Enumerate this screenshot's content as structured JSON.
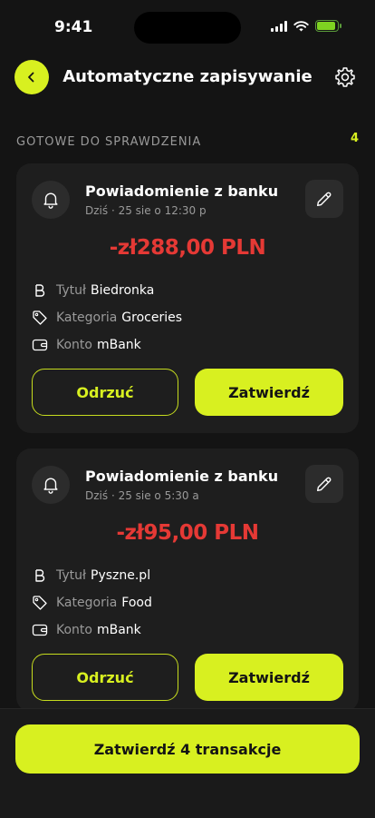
{
  "status_bar": {
    "time": "9:41"
  },
  "header": {
    "title": "Automatyczne zapisywanie"
  },
  "section": {
    "title": "GOTOWE DO SPRAWDZENIA",
    "count": "4"
  },
  "cards": [
    {
      "title": "Powiadomienie z banku",
      "time": "Dziś · 25 sie o 12:30 p",
      "amount": "-zł288,00 PLN",
      "details": [
        {
          "label": "Tytuł",
          "value": "Biedronka",
          "icon": "bold-b-icon"
        },
        {
          "label": "Kategoria",
          "value": "Groceries",
          "icon": "tag-icon"
        },
        {
          "label": "Konto",
          "value": "mBank",
          "icon": "wallet-icon"
        }
      ],
      "reject_label": "Odrzuć",
      "confirm_label": "Zatwierdź"
    },
    {
      "title": "Powiadomienie z banku",
      "time": "Dziś · 25 sie o 5:30 a",
      "amount": "-zł95,00 PLN",
      "details": [
        {
          "label": "Tytuł",
          "value": "Pyszne.pl",
          "icon": "bold-b-icon"
        },
        {
          "label": "Kategoria",
          "value": "Food",
          "icon": "tag-icon"
        },
        {
          "label": "Konto",
          "value": "mBank",
          "icon": "wallet-icon"
        }
      ],
      "reject_label": "Odrzuć",
      "confirm_label": "Zatwierdź"
    }
  ],
  "footer": {
    "confirm_all_label": "Zatwierdź 4 transakcje"
  },
  "colors": {
    "accent": "#d8f020",
    "negative": "#e53935",
    "background": "#141414",
    "card": "#1e1e1e"
  }
}
